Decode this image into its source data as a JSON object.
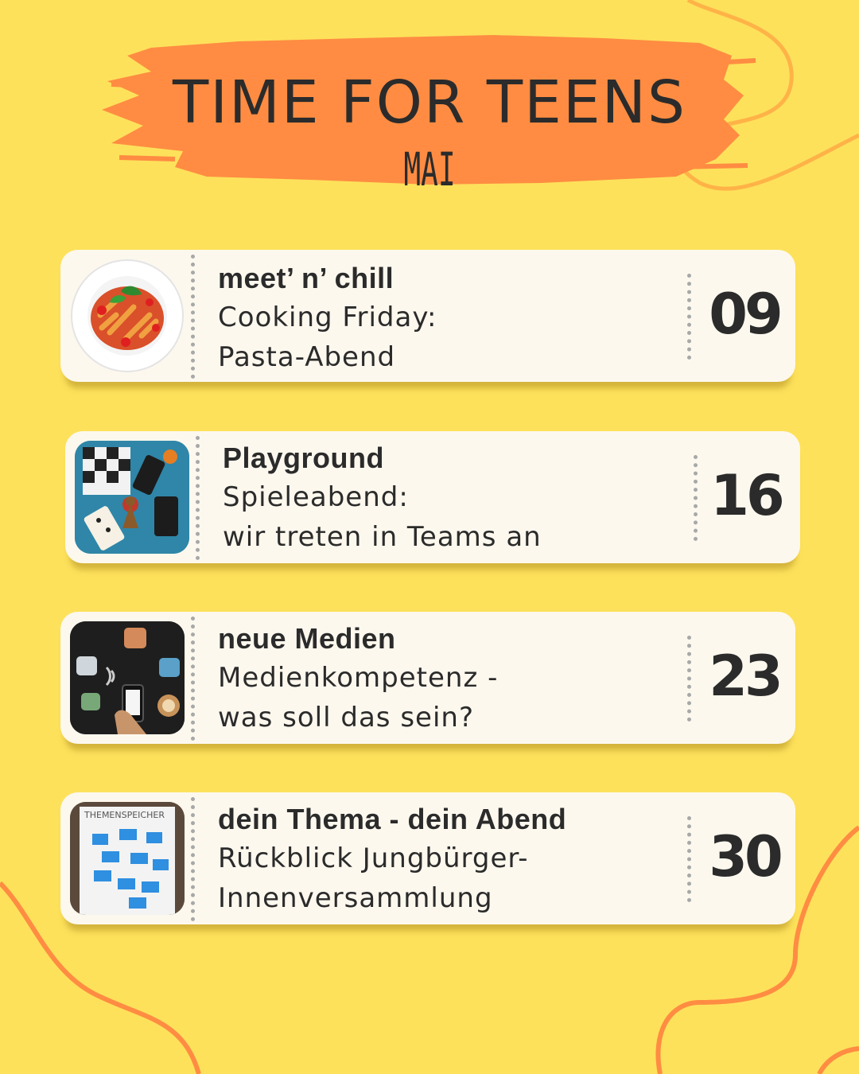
{
  "header": {
    "title": "TIME FOR TEENS",
    "subtitle": "MAI"
  },
  "colors": {
    "background": "#fde15b",
    "accent": "#ff8c42",
    "card": "#fdf8ee",
    "text": "#2b2b2b"
  },
  "events": [
    {
      "category": "meet’ n’ chill",
      "line1": "Cooking Friday:",
      "line2": "Pasta-Abend",
      "day": "09",
      "image": "pasta-plate-photo"
    },
    {
      "category": "Playground",
      "line1": "Spieleabend:",
      "line2": "wir treten in Teams an",
      "day": "16",
      "image": "board-games-photo"
    },
    {
      "category": "neue Medien",
      "line1": "Medienkompetenz -",
      "line2": "was soll das sein?",
      "day": "23",
      "image": "smartphone-apps-photo"
    },
    {
      "category": "dein Thema - dein Abend",
      "line1": "Rückblick Jungbürger-",
      "line2": "Innenversammlung",
      "day": "30",
      "image": "themenspeicher-board-photo"
    }
  ],
  "thumb_labels": {
    "board_heading": "THEMENSPEICHER"
  }
}
